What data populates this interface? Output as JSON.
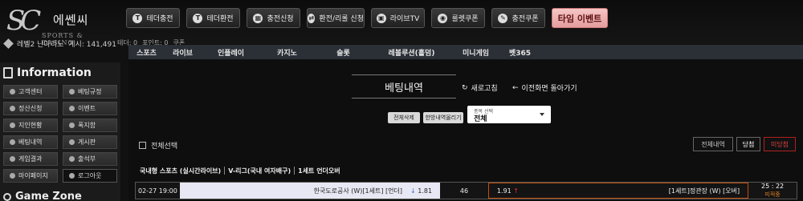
{
  "brand": {
    "logo_letters": "SC",
    "name": "에쎈씨",
    "sub": "SPORTS & CASINO"
  },
  "topnav": [
    {
      "label": "테더충전",
      "icon": "T",
      "icon_name": "tether-icon"
    },
    {
      "label": "테더환전",
      "icon": "T",
      "icon_name": "tether-icon"
    },
    {
      "label": "충전신청",
      "icon": "▦",
      "icon_name": "bank-icon"
    },
    {
      "label": "환전/리롤 신청",
      "icon": "⇄",
      "icon_name": "exchange-icon"
    },
    {
      "label": "라이브TV",
      "icon": "▣",
      "icon_name": "tv-icon"
    },
    {
      "label": "룰렛쿠폰",
      "icon": "◉",
      "icon_name": "roulette-icon"
    },
    {
      "label": "충전쿠폰",
      "icon": "✎",
      "icon_name": "coupon-icon"
    },
    {
      "label": "타임 이벤트",
      "icon": "",
      "icon_name": ""
    }
  ],
  "user": {
    "level": "레벨2 난마리노",
    "cash": "게시: 141,491",
    "tether": "테더: 0",
    "point": "포인트: 0",
    "coupon": "쿠폰"
  },
  "sportbar": [
    "스포츠",
    "라이브",
    "인플레이",
    "카지노",
    "슬롯",
    "레볼루션(홀덤)",
    "미니게임",
    "벳365"
  ],
  "sidebar": {
    "title": "Information",
    "items": [
      {
        "label": "고객센터"
      },
      {
        "label": "베팅규정"
      },
      {
        "label": "정산신청"
      },
      {
        "label": "이벤트"
      },
      {
        "label": "지인현황"
      },
      {
        "label": "폭지함"
      },
      {
        "label": "베팅내역"
      },
      {
        "label": "게시판"
      },
      {
        "label": "게임결과"
      },
      {
        "label": "출석부"
      },
      {
        "label": "마이페이지"
      },
      {
        "label": "로그아웃"
      }
    ],
    "title2": "Game Zone"
  },
  "main": {
    "title": "베팅내역",
    "refresh": "새로고침",
    "back": "이전화면 돌아가기",
    "delete_all": "전체삭제",
    "upload": "한방내역올리기",
    "select_label": "종목 선택",
    "select_value": "전체",
    "select_all": "전체선택",
    "filters": [
      "전체내역",
      "당첨",
      "미당첨"
    ]
  },
  "bet": {
    "league_parts": [
      "국내형 스포츠 (실시간라이브)",
      "V-리그(국내 여자배구)",
      "1세트 언더오버"
    ],
    "date": "02-27 19:00",
    "home": "한국도로공사 (W)[1세트] [언더]",
    "home_odds": "1.81",
    "draw": "46",
    "away_odds": "1.91",
    "away": "[1세트]정관장 (W) [오버]",
    "score": "25 : 22",
    "status": "미적중"
  }
}
